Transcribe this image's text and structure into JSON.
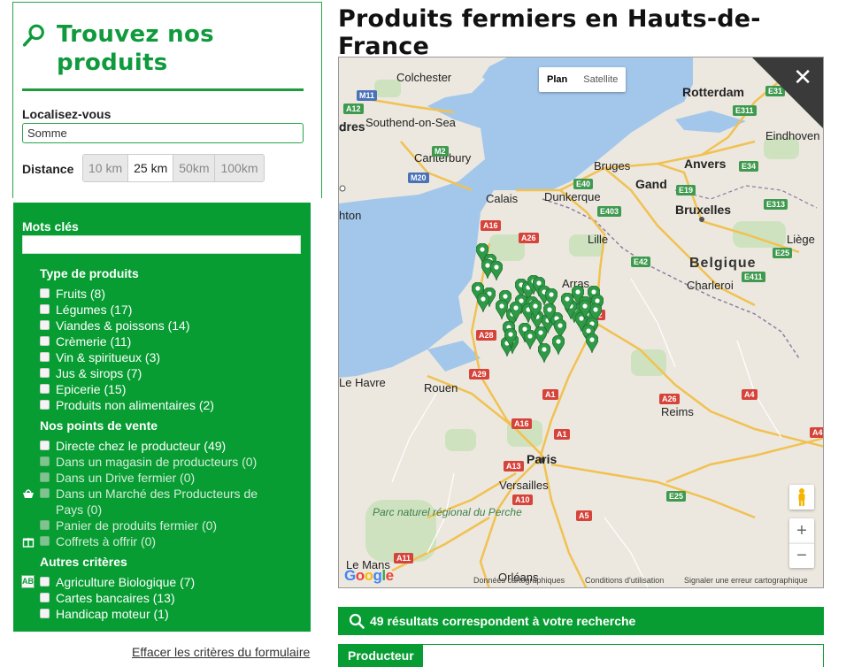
{
  "sidebar": {
    "title": "Trouvez nos produits",
    "location": {
      "label": "Localisez-vous",
      "value": "Somme"
    },
    "distance": {
      "label": "Distance",
      "options": [
        "10 km",
        "25 km",
        "50km",
        "100km"
      ],
      "selected": "25 km"
    },
    "keywords": {
      "label": "Mots clés",
      "value": ""
    },
    "product_types": {
      "title": "Type de produits",
      "items": [
        "Fruits (8)",
        "Légumes (17)",
        "Viandes & poissons (14)",
        "Crèmerie (11)",
        "Vin & spiritueux (3)",
        "Jus & sirops (7)",
        "Epicerie (15)",
        "Produits non alimentaires (2)"
      ]
    },
    "points_of_sale": {
      "title": "Nos points de vente",
      "items": [
        "Directe chez le producteur (49)",
        "Dans un magasin de producteurs (0)",
        "Dans un Drive fermier (0)",
        "Dans un Marché des Producteurs de Pays (0)",
        "Panier de produits fermier (0)",
        "Coffrets à offrir (0)"
      ]
    },
    "other_criteria": {
      "title": "Autres critères",
      "items": [
        "Agriculture Biologique (7)",
        "Cartes bancaires (13)",
        "Handicap moteur (1)"
      ]
    },
    "organic_badge": "AB",
    "clear_link": "Effacer les critères du formulaire"
  },
  "page": {
    "title": "Produits fermiers en Hauts-de-France"
  },
  "map": {
    "type_options": [
      "Plan",
      "Satellite"
    ],
    "selected_type": "Plan",
    "close_symbol": "✕",
    "zoom_in": "+",
    "zoom_out": "−",
    "attribution": {
      "data": "Données cartographiques",
      "terms": "Conditions d'utilisation",
      "report": "Signaler une erreur cartographique"
    },
    "logo": "Google",
    "labels": {
      "colchester": "Colchester",
      "southend": "Southend-on-Sea",
      "dres": "dres",
      "canterbury": "Canterbury",
      "hton": "hton",
      "calais": "Calais",
      "dunkerque": "Dunkerque",
      "rotterdam": "Rotterdam",
      "eindhoven": "Eindhoven",
      "bruges": "Bruges",
      "anvers": "Anvers",
      "gand": "Gand",
      "bruxelles": "Bruxelles",
      "lille": "Lille",
      "liege": "Liège",
      "belgique": "Belgique",
      "charleroi": "Charleroi",
      "arras": "Arras",
      "le_havre": "Le Havre",
      "rouen": "Rouen",
      "reims": "Reims",
      "paris": "Paris",
      "versailles": "Versailles",
      "parc": "Parc naturel régional du Perche",
      "le_mans": "Le Mans",
      "orleans": "Orléans"
    },
    "roads": [
      "M11",
      "A12",
      "M2",
      "M20",
      "E31",
      "E311",
      "A16",
      "A26",
      "E40",
      "E403",
      "E19",
      "E34",
      "E313",
      "E42",
      "A2",
      "E411",
      "E25",
      "A1",
      "A28",
      "A29",
      "A4",
      "A26",
      "A16",
      "A13",
      "A10",
      "A5",
      "A11",
      "A4",
      "A1",
      "E25"
    ]
  },
  "results": {
    "text": "49 résultats correspondent à votre recherche"
  },
  "tabs": {
    "active": "Producteur"
  },
  "colors": {
    "brand_green": "#079d33",
    "title_green": "#0f9a3c",
    "marker_green": "#2f9a46",
    "water": "#a3c7eb"
  }
}
